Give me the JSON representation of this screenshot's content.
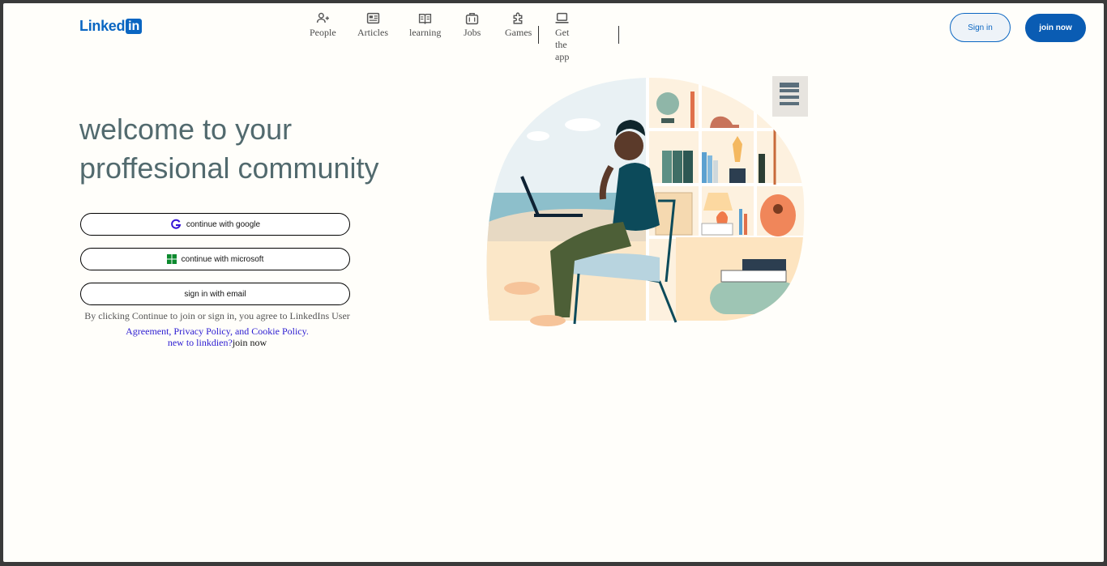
{
  "brand": {
    "logo_word": "Linked",
    "logo_box": "in"
  },
  "nav": {
    "people": "People",
    "articles": "Articles",
    "learning": "learning",
    "jobs": "Jobs",
    "games": "Games",
    "get_app": "Get the app"
  },
  "header": {
    "sign_in": "Sign in",
    "join_now": "join now"
  },
  "hero": {
    "headline_line1": "welcome to your",
    "headline_line2": "proffesional community"
  },
  "auth": {
    "google": "continue with google",
    "microsoft": "continue with microsoft",
    "email": "sign in with email"
  },
  "terms": {
    "line1": "By clicking Continue to join or sign in, you agree to LinkedIns User",
    "line2": "Agreement, Privacy Policy, and Cookie Policy."
  },
  "signup": {
    "link": "new to linkdien?",
    "join": "join now"
  },
  "colors": {
    "brand_blue": "#0a66c2",
    "headline": "#526a6e",
    "link": "#2b1bd1"
  },
  "icons": [
    "people-icon",
    "articles-icon",
    "learning-icon",
    "jobs-icon",
    "games-icon",
    "laptop-icon",
    "google-icon",
    "microsoft-icon"
  ]
}
